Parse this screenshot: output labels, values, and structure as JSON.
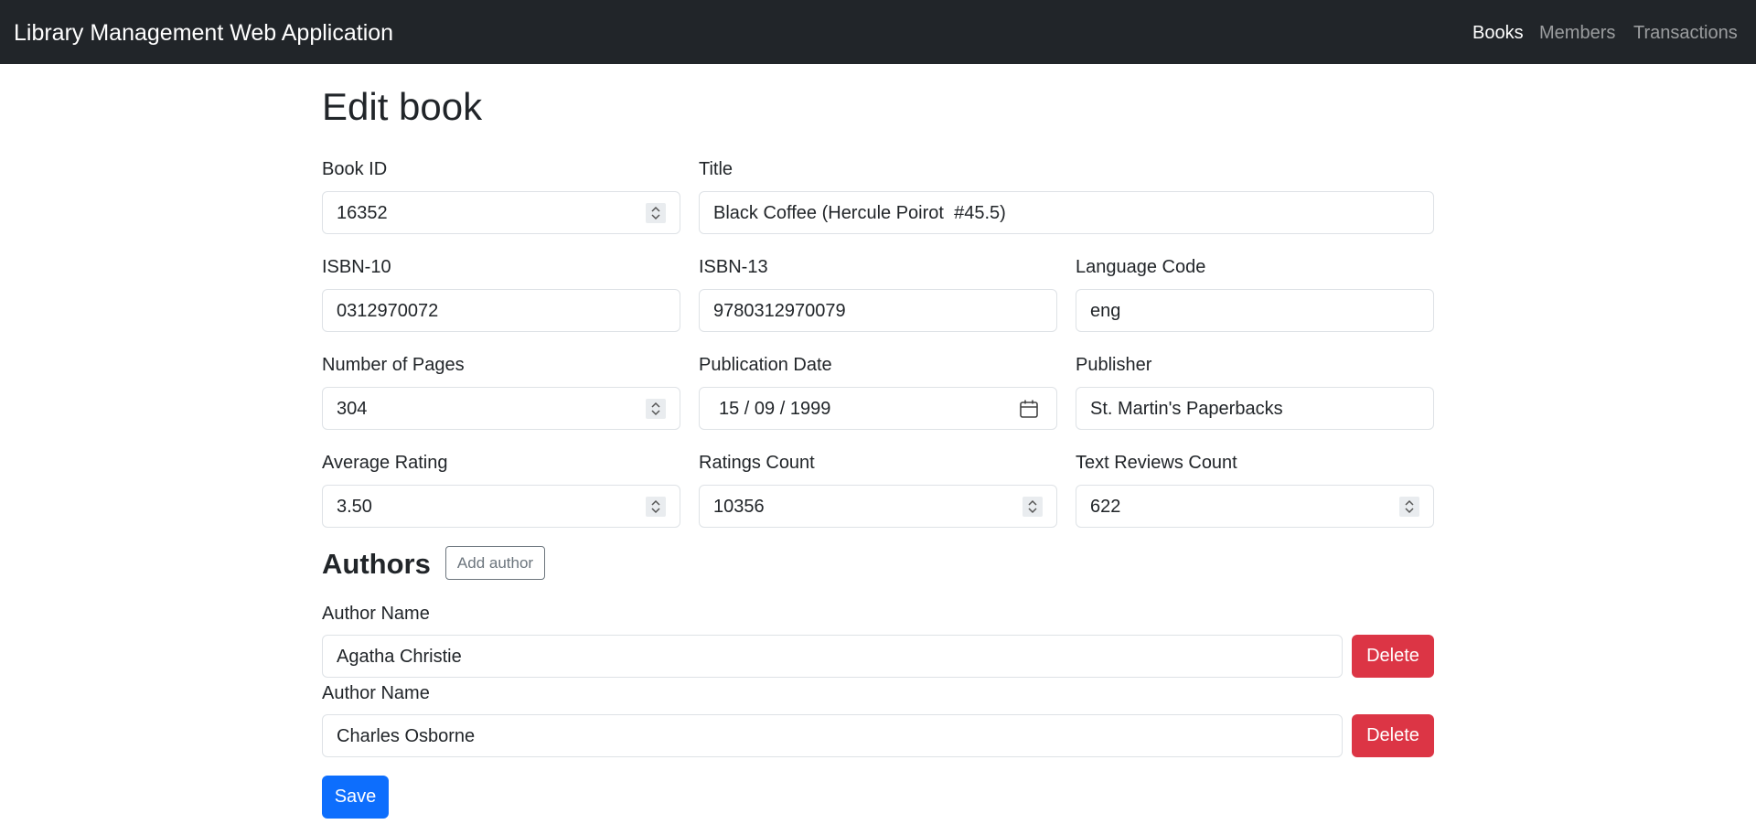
{
  "nav": {
    "brand": "Library Management Web Application",
    "links": [
      "Books",
      "Members",
      "Transactions"
    ],
    "active": "Books"
  },
  "page": {
    "title": "Edit book"
  },
  "form": {
    "book_id": {
      "label": "Book ID",
      "value": "16352"
    },
    "title": {
      "label": "Title",
      "value": "Black Coffee (Hercule Poirot  #45.5)"
    },
    "isbn10": {
      "label": "ISBN-10",
      "value": "0312970072"
    },
    "isbn13": {
      "label": "ISBN-13",
      "value": "9780312970079"
    },
    "language_code": {
      "label": "Language Code",
      "value": "eng"
    },
    "num_pages": {
      "label": "Number of Pages",
      "value": "304"
    },
    "publication_date": {
      "label": "Publication Date",
      "value": "15 / 09 / 1999"
    },
    "publisher": {
      "label": "Publisher",
      "value": "St. Martin's Paperbacks"
    },
    "average_rating": {
      "label": "Average Rating",
      "value": "3.50"
    },
    "ratings_count": {
      "label": "Ratings Count",
      "value": "10356"
    },
    "text_reviews_count": {
      "label": "Text Reviews Count",
      "value": "622"
    }
  },
  "authors": {
    "title": "Authors",
    "add_label": "Add author",
    "items": [
      {
        "label": "Author Name",
        "value": "Agatha Christie",
        "delete_label": "Delete"
      },
      {
        "label": "Author Name",
        "value": "Charles Osborne",
        "delete_label": "Delete"
      }
    ]
  },
  "save_label": "Save",
  "colors": {
    "navbar": "#212529",
    "primary": "#0d6efd",
    "danger": "#dc3545",
    "secondary": "#6c757d",
    "border": "#dee2e6"
  },
  "icons": [
    "spinner-icon",
    "calendar-icon"
  ]
}
